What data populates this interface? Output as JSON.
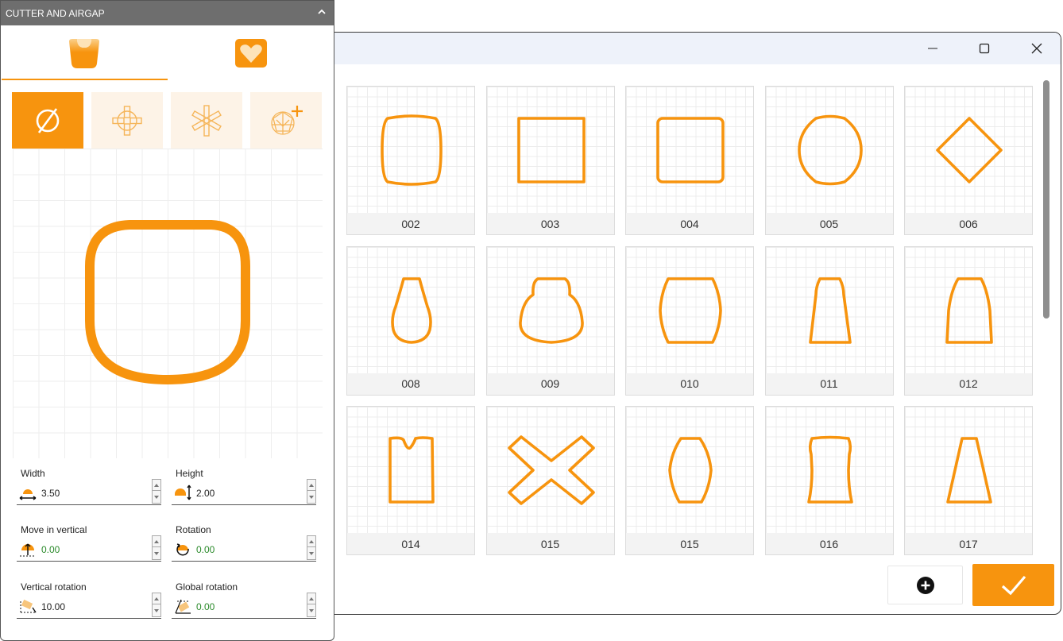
{
  "panel": {
    "title": "CUTTER AND AIRGAP",
    "fields": [
      {
        "label": "Width",
        "value": "3.50",
        "icon": "width-icon",
        "green": false
      },
      {
        "label": "Height",
        "value": "2.00",
        "icon": "height-icon",
        "green": false
      },
      {
        "label": "Move in vertical",
        "value": "0.00",
        "icon": "move-vertical-icon",
        "green": true
      },
      {
        "label": "Rotation",
        "value": "0.00",
        "icon": "rotation-icon",
        "green": true
      },
      {
        "label": "Vertical rotation",
        "value": "10.00",
        "icon": "vertical-rotation-icon",
        "green": false
      },
      {
        "label": "Global rotation",
        "value": "0.00",
        "icon": "global-rotation-icon",
        "green": true
      }
    ]
  },
  "library": {
    "shapes": [
      "002",
      "003",
      "004",
      "005",
      "006",
      "008",
      "009",
      "010",
      "011",
      "012",
      "014",
      "015",
      "015",
      "016",
      "017"
    ]
  },
  "colors": {
    "accent": "#f7940e",
    "active_tool": "#f7940e",
    "tool_bg": "#fdf3e7"
  }
}
